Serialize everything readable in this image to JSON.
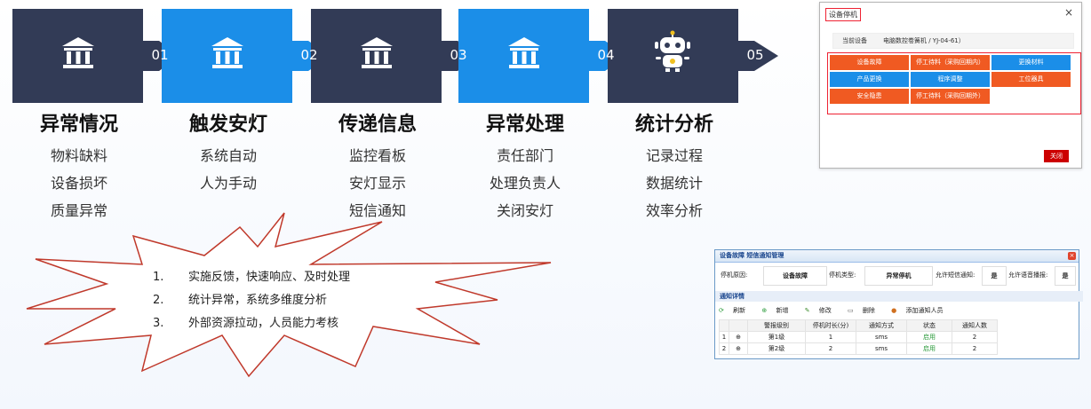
{
  "flow": {
    "steps": [
      {
        "num": "01",
        "title": "异常情况",
        "items": [
          "物料缺料",
          "设备损坏",
          "质量异常"
        ],
        "color": "#323b56",
        "icon": "bank-icon"
      },
      {
        "num": "02",
        "title": "触发安灯",
        "items": [
          "系统自动",
          "人为手动"
        ],
        "color": "#1b8ee8",
        "icon": "bank-icon"
      },
      {
        "num": "03",
        "title": "传递信息",
        "items": [
          "监控看板",
          "安灯显示",
          "短信通知"
        ],
        "color": "#323b56",
        "icon": "bank-icon"
      },
      {
        "num": "04",
        "title": "异常处理",
        "items": [
          "责任部门",
          "处理负责人",
          "关闭安灯"
        ],
        "color": "#1b8ee8",
        "icon": "bank-icon"
      },
      {
        "num": "05",
        "title": "统计分析",
        "items": [
          "记录过程",
          "数据统计",
          "效率分析"
        ],
        "color": "#323b56",
        "icon": "robot-icon"
      }
    ]
  },
  "callout": {
    "items": [
      {
        "num": "1.",
        "text": "实施反馈，快速响应、及时处理"
      },
      {
        "num": "2.",
        "text": "统计异常，系统多维度分析"
      },
      {
        "num": "3.",
        "text": "外部资源拉动，人员能力考核"
      }
    ]
  },
  "stop_dialog": {
    "title": "设备停机",
    "close_icon": "×",
    "device_label": "当前设备",
    "device_value": "电脑数控卷簧机 / YJ-04-61）",
    "reasons": [
      {
        "label": "设备故障",
        "color": "#f05a22"
      },
      {
        "label": "停工待料（采购回期内）",
        "color": "#f05a22"
      },
      {
        "label": "更换材料",
        "color": "#1b8ee8"
      },
      {
        "label": "产品更换",
        "color": "#1b8ee8"
      },
      {
        "label": "程序调整",
        "color": "#1b8ee8"
      },
      {
        "label": "工位器具",
        "color": "#f05a22"
      },
      {
        "label": "安全隐患",
        "color": "#f05a22"
      },
      {
        "label": "停工待料（采购回期外）",
        "color": "#f05a22"
      }
    ],
    "close_button": "关闭"
  },
  "sms_dialog": {
    "title": "设备故障 短信通知管理",
    "form": {
      "reason_label": "停机原因:",
      "reason_value": "设备故障",
      "type_label": "停机类型:",
      "type_value": "异常停机",
      "sms_label": "允许短信通知:",
      "sms_value": "是",
      "voice_label": "允许语音播报:",
      "voice_value": "是"
    },
    "section_title": "通知详情",
    "toolbar": [
      "刷新",
      "新增",
      "修改",
      "删除",
      "添加通知人员"
    ],
    "columns": [
      "",
      "",
      "警报级别",
      "停机时长(分)",
      "通知方式",
      "状态",
      "通知人数"
    ],
    "rows": [
      {
        "idx": "1",
        "level": "第1级",
        "duration": "1",
        "method": "sms",
        "status": "启用",
        "count": "2"
      },
      {
        "idx": "2",
        "level": "第2级",
        "duration": "2",
        "method": "sms",
        "status": "启用",
        "count": "2"
      }
    ]
  }
}
